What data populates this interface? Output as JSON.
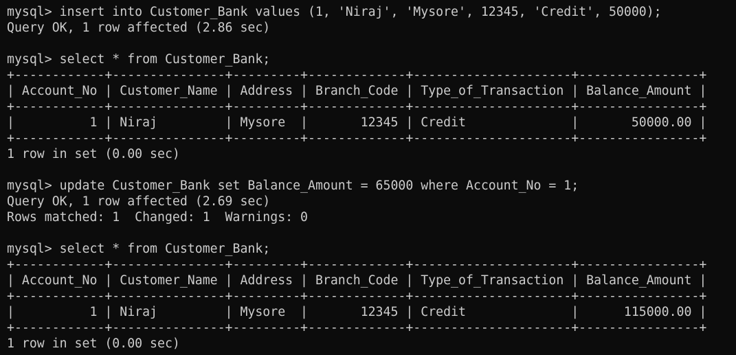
{
  "terminal": {
    "lines": [
      "mysql> insert into Customer_Bank values (1, 'Niraj', 'Mysore', 12345, 'Credit', 50000);",
      "Query OK, 1 row affected (2.86 sec)",
      "",
      "mysql> select * from Customer_Bank;",
      "+------------+---------------+---------+-------------+---------------------+----------------+",
      "| Account_No | Customer_Name | Address | Branch_Code | Type_of_Transaction | Balance_Amount |",
      "+------------+---------------+---------+-------------+---------------------+----------------+",
      "|          1 | Niraj         | Mysore  |       12345 | Credit              |       50000.00 |",
      "+------------+---------------+---------+-------------+---------------------+----------------+",
      "1 row in set (0.00 sec)",
      "",
      "mysql> update Customer_Bank set Balance_Amount = 65000 where Account_No = 1;",
      "Query OK, 1 row affected (2.69 sec)",
      "Rows matched: 1  Changed: 1  Warnings: 0",
      "",
      "mysql> select * from Customer_Bank;",
      "+------------+---------------+---------+-------------+---------------------+----------------+",
      "| Account_No | Customer_Name | Address | Branch_Code | Type_of_Transaction | Balance_Amount |",
      "+------------+---------------+---------+-------------+---------------------+----------------+",
      "|          1 | Niraj         | Mysore  |       12345 | Credit              |      115000.00 |",
      "+------------+---------------+---------+-------------+---------------------+----------------+",
      "1 row in set (0.00 sec)"
    ]
  },
  "colors": {
    "background": "#0c0c0c",
    "text": "#cccccc"
  }
}
